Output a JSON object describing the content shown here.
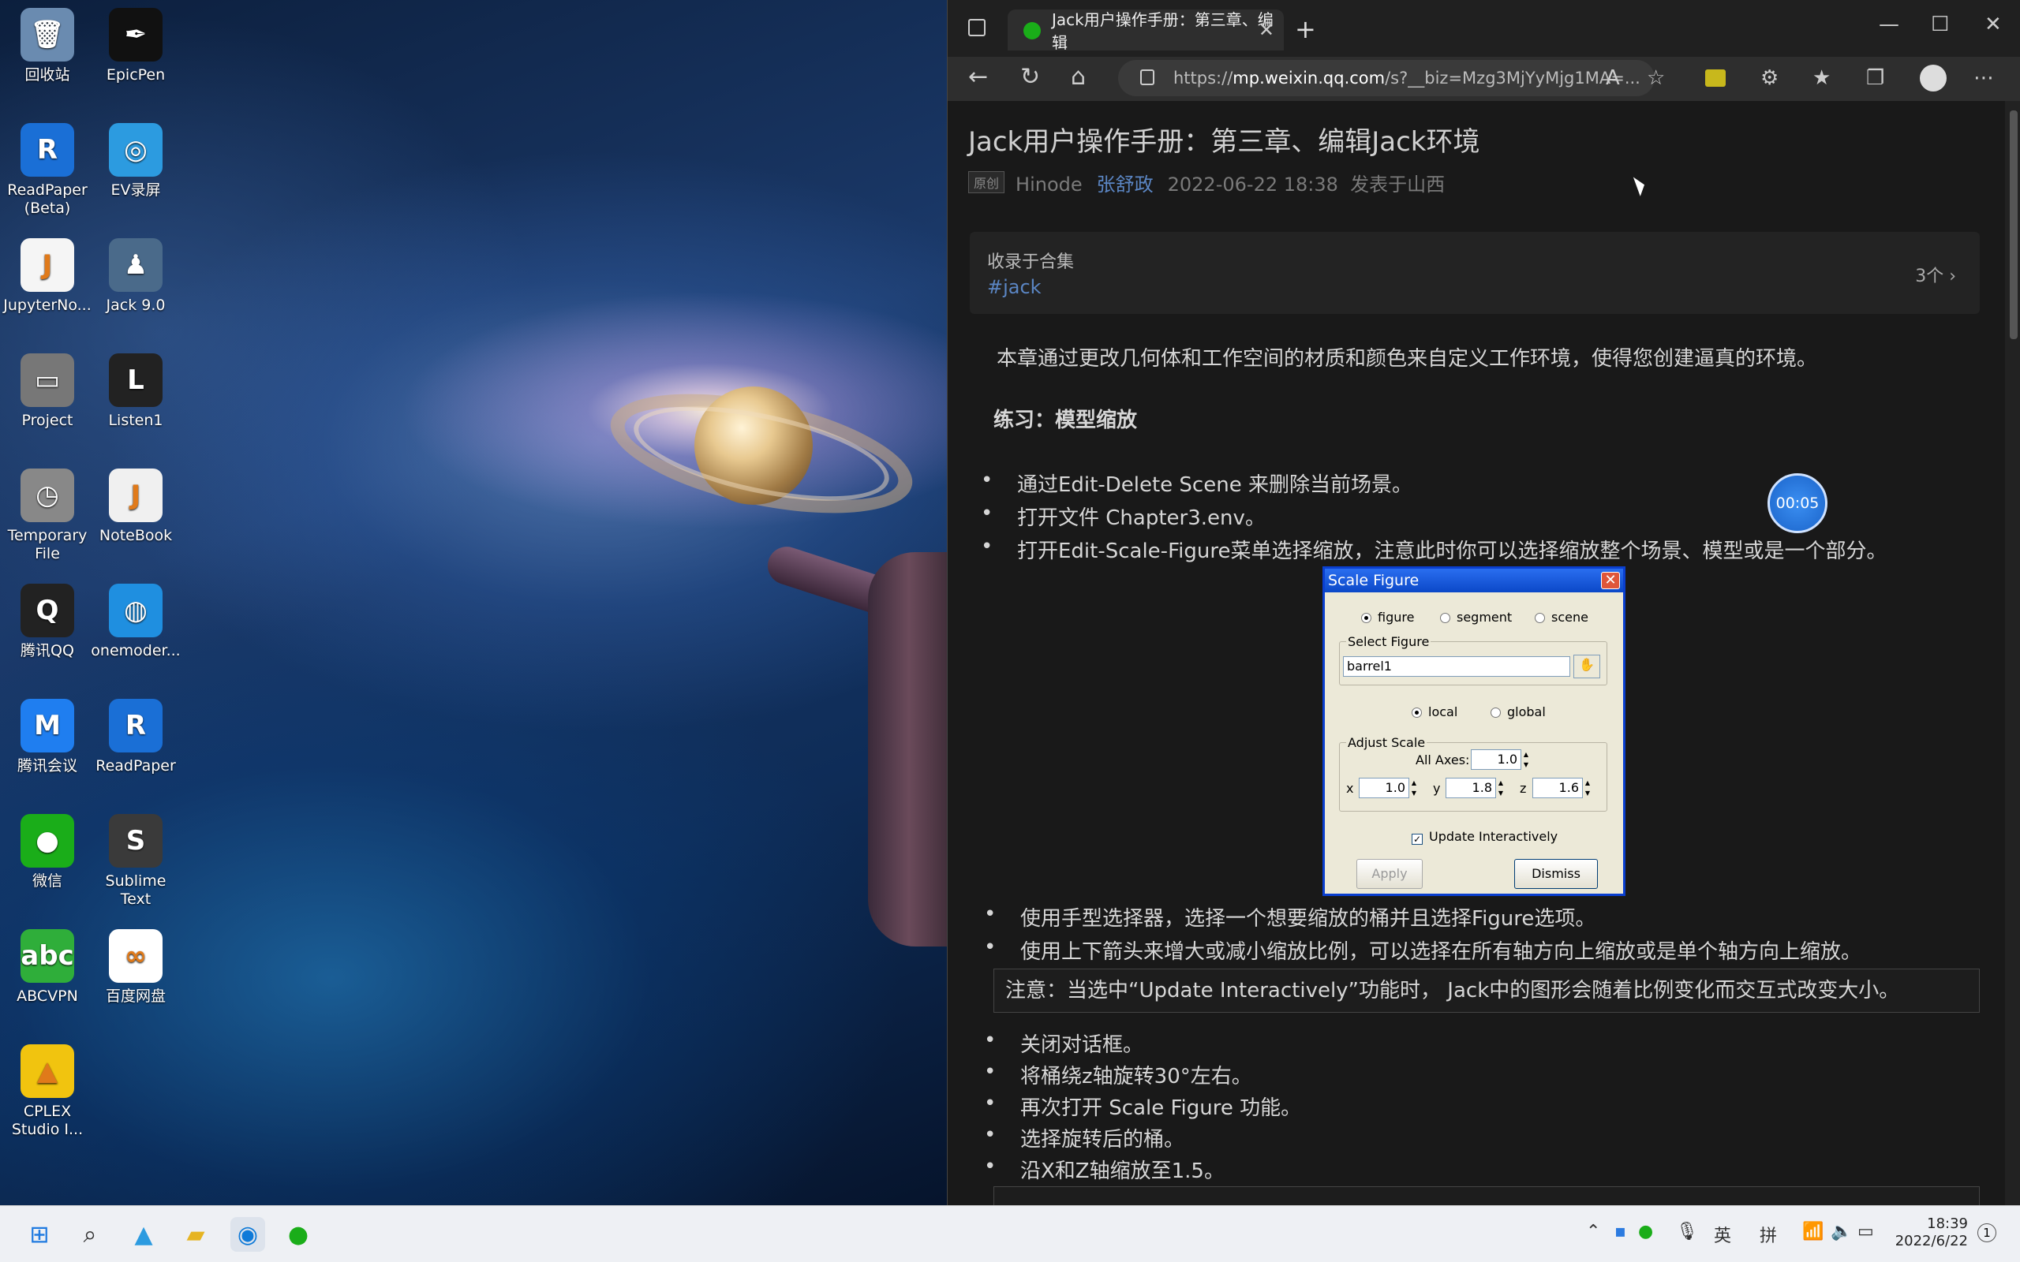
{
  "desktop": {
    "icons": [
      {
        "label": "回收站",
        "glyph": "🗑",
        "color": "#6a8bb0"
      },
      {
        "label": "EpicPen",
        "glyph": "✒",
        "color": "#111"
      },
      {
        "label": "ReadPaper (Beta)",
        "glyph": "R",
        "color": "#1a6fd6"
      },
      {
        "label": "EV录屏",
        "glyph": "◎",
        "color": "#2c9be0"
      },
      {
        "label": "JupyterNo...",
        "glyph": "J",
        "color": "#f5f5f5"
      },
      {
        "label": "Jack 9.0",
        "glyph": "♟",
        "color": "#4a6a8a"
      },
      {
        "label": "Project",
        "glyph": "▭",
        "color": "#777"
      },
      {
        "label": "Listen1",
        "glyph": "L",
        "color": "#222"
      },
      {
        "label": "Temporary File",
        "glyph": "◷",
        "color": "#888"
      },
      {
        "label": "NoteBook",
        "glyph": "J",
        "color": "#f0f0f0"
      },
      {
        "label": "腾讯QQ",
        "glyph": "Q",
        "color": "#222"
      },
      {
        "label": "onemoder...",
        "glyph": "◍",
        "color": "#1f8fe0"
      },
      {
        "label": "腾讯会议",
        "glyph": "M",
        "color": "#1f7ef0"
      },
      {
        "label": "ReadPaper",
        "glyph": "R",
        "color": "#1a6fd6"
      },
      {
        "label": "微信",
        "glyph": "●",
        "color": "#1aad19"
      },
      {
        "label": "Sublime Text",
        "glyph": "S",
        "color": "#3a3a3a"
      },
      {
        "label": "ABCVPN",
        "glyph": "abc",
        "color": "#2fae3a"
      },
      {
        "label": "百度网盘",
        "glyph": "∞",
        "color": "#ffffff"
      },
      {
        "label": "CPLEX Studio I...",
        "glyph": "▲",
        "color": "#f1c40f"
      }
    ]
  },
  "browser": {
    "tab_title": "Jack用户操作手册：第三章、编辑",
    "url_host": "mp.weixin.qq.com",
    "url_prefix": "https://",
    "url_rest": "/s?__biz=Mzg3MjYyMjg1MA=...",
    "article": {
      "title": "Jack用户操作手册：第三章、编辑Jack环境",
      "original_tag": "原创",
      "account": "Hinode",
      "author": "张舒政",
      "date": "2022-06-22 18:38",
      "location": "发表于山西",
      "collection_label": "收录于合集",
      "collection_tag": "#jack",
      "collection_count": "3个",
      "intro": "本章通过更改几何体和工作空间的材质和颜色来自定义工作环境，使得您创建逼真的环境。",
      "section": "练习：模型缩放",
      "bullets1": [
        "通过Edit-Delete Scene 来删除当前场景。",
        "打开文件 Chapter3.env。",
        "打开Edit-Scale-Figure菜单选择缩放，注意此时你可以选择缩放整个场景、模型或是一个部分。"
      ],
      "bullets2": [
        "使用手型选择器，选择一个想要缩放的桶并且选择Figure选项。",
        "使用上下箭头来增大或减小缩放比例，可以选择在所有轴方向上缩放或是单个轴方向上缩放。"
      ],
      "note1": "注意：当选中“Update Interactively”功能时， Jack中的图形会随着比例变化而交互式改变大小。",
      "bullets3": [
        "关闭对话框。",
        "将桶绕z轴旋转30°左右。",
        "再次打开 Scale Figure 功能。",
        "选择旋转后的桶。",
        "沿X和Z轴缩放至1.5。"
      ]
    },
    "dialog": {
      "title": "Scale Figure",
      "opt_figure": "figure",
      "opt_segment": "segment",
      "opt_scene": "scene",
      "select_label": "Select Figure",
      "select_value": "barrel1",
      "opt_local": "local",
      "opt_global": "global",
      "adjust_label": "Adjust Scale",
      "all_axes_label": "All Axes:",
      "all_axes": "1.0",
      "x_label": "x",
      "x": "1.0",
      "y_label": "y",
      "y": "1.8",
      "z_label": "z",
      "z": "1.6",
      "update_label": "Update Interactively",
      "apply": "Apply",
      "dismiss": "Dismiss"
    }
  },
  "timer": "00:05",
  "taskbar": {
    "ime1": "英",
    "ime2": "拼",
    "time": "18:39",
    "date": "2022/6/22",
    "badge": "1"
  }
}
